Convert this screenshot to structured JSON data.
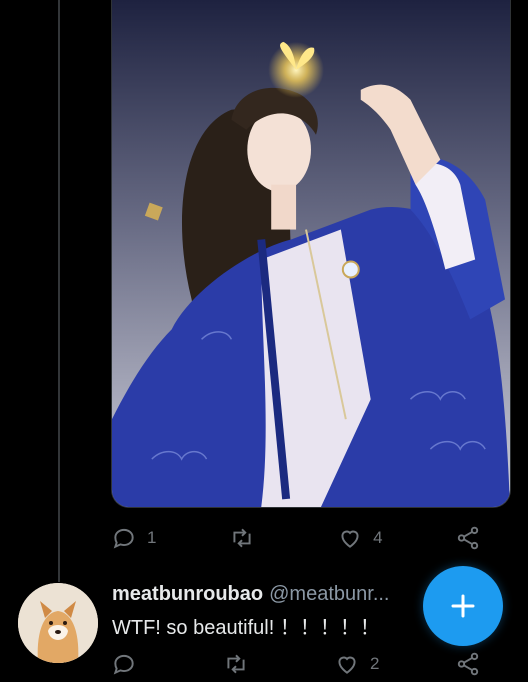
{
  "tweet": {
    "image_alt": "Illustration of a long-haired figure in blue robes holding a glowing butterfly",
    "actions": {
      "reply_count": "1",
      "retweet_count": "",
      "like_count": "4"
    }
  },
  "reply": {
    "display_name": "meatbunroubao",
    "handle": "@meatbunr...",
    "text": "WTF! so beautiful! ！！！！！",
    "actions": {
      "reply_count": "",
      "retweet_count": "",
      "like_count": "2"
    }
  },
  "compose_button_icon": "plus-icon",
  "colors": {
    "background": "#000000",
    "accent": "#1d9bf0",
    "muted": "#71767b",
    "text": "#e7e9ea"
  }
}
